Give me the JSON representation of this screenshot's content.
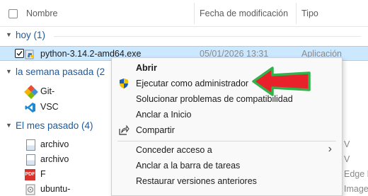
{
  "columns": {
    "name": "Nombre",
    "date": "Fecha de modificación",
    "type": "Tipo"
  },
  "groups": [
    {
      "label": "hoy (1)"
    },
    {
      "label": "la semana pasada (2"
    },
    {
      "label": "El mes pasado (4)"
    }
  ],
  "files": [
    {
      "name": "python-3.14.2-amd64.exe",
      "date": "05/01/2026 13:31",
      "type": "Aplicación",
      "icon": "python-installer-icon",
      "selected": true
    },
    {
      "name": "Git-",
      "icon": "git-icon"
    },
    {
      "name": "VSC",
      "icon": "vscode-icon"
    },
    {
      "name": "archivo",
      "icon": "document-icon",
      "side": "V"
    },
    {
      "name": "archivo",
      "icon": "document-icon",
      "side": "V"
    },
    {
      "name": "F",
      "icon": "pdf-icon",
      "side": "Edge P"
    },
    {
      "name": "ubuntu-",
      "icon": "disc-image-icon",
      "side": "Image"
    }
  ],
  "context_menu": {
    "items": [
      {
        "label": "Abrir",
        "bold": true
      },
      {
        "label": "Ejecutar como administrador",
        "icon": "uac-shield-icon"
      },
      {
        "label": "Solucionar problemas de compatibilidad"
      },
      {
        "label": "Anclar a Inicio"
      },
      {
        "label": "Compartir",
        "icon": "share-icon"
      },
      {
        "label": "Conceder acceso a",
        "submenu": true
      },
      {
        "label": "Anclar a la barra de tareas"
      },
      {
        "label": "Restaurar versiones anteriores"
      }
    ]
  },
  "annotation": {
    "shape": "arrow",
    "fill": "#e8212b",
    "outline": "#2fb34a",
    "direction": "left"
  },
  "colors": {
    "selection": "#cce8ff",
    "group_header": "#1c5a9e",
    "accent": "#0067c0"
  }
}
